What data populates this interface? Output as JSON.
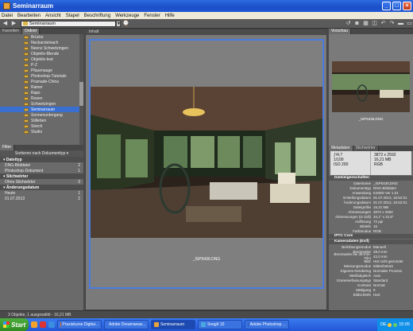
{
  "window": {
    "title": "Seminarraum"
  },
  "menu": [
    "Datei",
    "Bearbeiten",
    "Ansicht",
    "Stapel",
    "Beschriftung",
    "Werkzeuge",
    "Fenster",
    "Hilfe"
  ],
  "path": {
    "value": "Seminarraum"
  },
  "panels": {
    "folders_tabs": [
      "Favoriten",
      "Ordner"
    ],
    "content_tab": "Inhalt",
    "preview_tab": "Vorschau",
    "meta_tabs": [
      "Metadaten",
      "Stichwörter"
    ],
    "filter_tab": "Filter"
  },
  "folders": [
    {
      "label": "Brücke"
    },
    {
      "label": "Neckarsteinach"
    },
    {
      "label": "Neenz Schwetzingen"
    },
    {
      "label": "Objektiv-Blende"
    },
    {
      "label": "Objektiv-test"
    },
    {
      "label": "P-Z"
    },
    {
      "label": "Pfauenauge"
    },
    {
      "label": "Photoshop-Tutorials"
    },
    {
      "label": "Pramade-China"
    },
    {
      "label": "Rainer"
    },
    {
      "label": "Raps"
    },
    {
      "label": "Rosen"
    },
    {
      "label": "Schwetzingen"
    },
    {
      "label": "Seminarraum",
      "selected": true
    },
    {
      "label": "Sonnenuntergang"
    },
    {
      "label": "Stilleben"
    },
    {
      "label": "Storch"
    },
    {
      "label": "Studio"
    }
  ],
  "filter": {
    "sort_label": "Sortieren nach Dokumenttyp",
    "groups": [
      {
        "title": "Dateityp",
        "rows": [
          {
            "label": "DNG-Bilddatei",
            "count": "2"
          },
          {
            "label": "Photoshop-Dokument",
            "count": "1"
          }
        ]
      },
      {
        "title": "Stichwörter",
        "rows": [
          {
            "label": "Ohne Stichwörter",
            "count": "3"
          }
        ]
      },
      {
        "title": "Änderungsdatum",
        "rows": [
          {
            "label": "Heute",
            "count": "1"
          },
          {
            "label": "01.07.2013",
            "count": "2"
          }
        ]
      }
    ]
  },
  "content": {
    "caption": "_ISP5436.DNG"
  },
  "preview": {
    "caption": "_ISP5436.DNG"
  },
  "infobox": {
    "aperture": "ƒ/4,7",
    "shutter": "1/100",
    "dims": "3872 x 2592",
    "size": "16,21 MB",
    "iso": "ISO 200",
    "unit": "RGB"
  },
  "metadata": {
    "groups": [
      {
        "title": "Dateieigenschaften",
        "rows": [
          {
            "k": "Dateiname",
            "v": "_ISP5436.DNG"
          },
          {
            "k": "Dokumenttyp",
            "v": "DNG-Bilddatei"
          },
          {
            "k": "Anwendung",
            "v": "K200D Ver 1.01"
          },
          {
            "k": "Erstellungsdatum",
            "v": "01.07.2013, 15:52:01"
          },
          {
            "k": "Änderungsdatum",
            "v": "01.07.2013, 15:52:01"
          },
          {
            "k": "Dateigröße",
            "v": "16,21 MB"
          },
          {
            "k": "Abmessungen",
            "v": "3872 x 2592"
          },
          {
            "k": "Abmessungen (in Zoll)",
            "v": "34,1\" x 22,8\""
          },
          {
            "k": "Auflösung",
            "v": "72 ppi"
          },
          {
            "k": "Bittiefe",
            "v": "16"
          },
          {
            "k": "Farbmodus",
            "v": "RGB"
          }
        ]
      },
      {
        "title": "IPTC Core",
        "rows": []
      },
      {
        "title": "Kameradaten (Exif)",
        "rows": [
          {
            "k": "Belichtungsmodus",
            "v": "Manuell"
          },
          {
            "k": "Brennweite",
            "v": "28,0 mm"
          },
          {
            "k": "Brennweite bei 35-mm-Film",
            "v": "42,0 mm"
          },
          {
            "k": "Blitz",
            "v": "Hat nicht gezündet"
          },
          {
            "k": "Messungsmodus",
            "v": "Mittenbetont"
          },
          {
            "k": "Eigenes Rendering",
            "v": "Normaler Prozess"
          },
          {
            "k": "Weißabgleich",
            "v": "Auto"
          },
          {
            "k": "Szenenerfassungstyp",
            "v": "Standard"
          },
          {
            "k": "Kontrast",
            "v": "Normal"
          },
          {
            "k": "Sättigung",
            "v": "0"
          },
          {
            "k": "Bildschärfe",
            "v": "Hart"
          }
        ]
      }
    ]
  },
  "status": {
    "text": "3 Objekte, 1 ausgewählt - 16,21 MB"
  },
  "taskbar": {
    "start": "Start",
    "items": [
      {
        "label": "Praxiskurse Digital...",
        "color": "#e46b2a"
      },
      {
        "label": "Adobe Dreamweav...",
        "color": "#35a14a"
      },
      {
        "label": "Seminarraum",
        "color": "#e8a33c",
        "active": true
      },
      {
        "label": "SnagIt 10",
        "color": "#4aa8e0"
      },
      {
        "label": "Adobe Photoshop ...",
        "color": "#2a5fb0"
      }
    ],
    "tray": {
      "lang": "DE",
      "time": "15:05"
    }
  }
}
